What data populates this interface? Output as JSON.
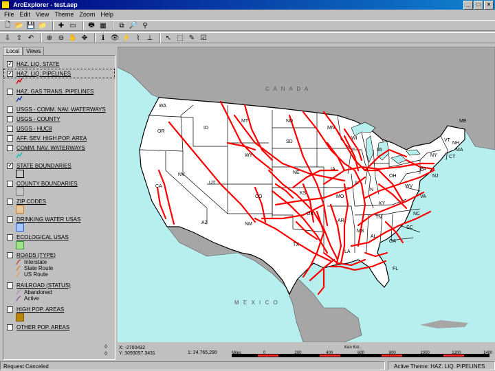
{
  "window": {
    "title": "ArcExplorer - test.aep",
    "minimize": "_",
    "maximize": "□",
    "close": "×"
  },
  "menu": [
    "File",
    "Edit",
    "View",
    "Theme",
    "Zoom",
    "Help"
  ],
  "toolbar1": [
    {
      "icon": "new-icon",
      "glyph": "🗋"
    },
    {
      "icon": "open-icon",
      "glyph": "📂"
    },
    {
      "icon": "save-icon",
      "glyph": "💾"
    },
    {
      "icon": "open-folder-icon",
      "glyph": "📁"
    },
    {
      "icon": "add-theme-icon",
      "glyph": "✚"
    },
    {
      "icon": "remove-theme-icon",
      "glyph": "▭"
    },
    {
      "icon": "print-icon",
      "glyph": "🖶"
    },
    {
      "icon": "table-icon",
      "glyph": "▦"
    },
    {
      "icon": "copy-map-icon",
      "glyph": "⧉"
    },
    {
      "icon": "query-icon",
      "glyph": "🔎"
    },
    {
      "icon": "locate-icon",
      "glyph": "⚲"
    }
  ],
  "toolbar2": [
    {
      "icon": "export-icon",
      "glyph": "⇩"
    },
    {
      "icon": "import-icon",
      "glyph": "⇧"
    },
    {
      "icon": "undo-icon",
      "glyph": "↶"
    },
    {
      "icon": "zoom-in-icon",
      "glyph": "⊕"
    },
    {
      "icon": "zoom-out-icon",
      "glyph": "⊖"
    },
    {
      "icon": "pan-icon",
      "glyph": "✋"
    },
    {
      "icon": "move-icon",
      "glyph": "✥"
    },
    {
      "icon": "identify-icon",
      "glyph": "ℹ"
    },
    {
      "icon": "find-icon",
      "glyph": "👁"
    },
    {
      "icon": "hyperlink-icon",
      "glyph": "⚡"
    },
    {
      "icon": "measure-icon",
      "glyph": "⌇"
    },
    {
      "icon": "buffer-icon",
      "glyph": "⊥"
    },
    {
      "icon": "select-icon",
      "glyph": "↖"
    },
    {
      "icon": "select-box-icon",
      "glyph": "⬚"
    },
    {
      "icon": "clear-selection-icon",
      "glyph": "✎"
    },
    {
      "icon": "properties-icon",
      "glyph": "☑"
    }
  ],
  "tabs": [
    "Local",
    "Views"
  ],
  "layers": [
    {
      "name": "HAZ. LIQ. STATE",
      "checked": true
    },
    {
      "name": "HAZ. LIQ. PIPELINES",
      "checked": true,
      "symbol_color": "#e00000"
    },
    {
      "name": "HAZ. GAS TRANS. PIPELINES",
      "checked": false,
      "symbol_color": "#1f3fb0"
    },
    {
      "name": "USGS - COMM. NAV. WATERWAYS",
      "checked": false
    },
    {
      "name": "USGS - COUNTY",
      "checked": false
    },
    {
      "name": "USGS - HUC8",
      "checked": false
    },
    {
      "name": "AFF. SEV. HIGH POP. AREA",
      "checked": false
    },
    {
      "name": "COMM. NAV. WATERWAYS",
      "checked": false,
      "symbol_color": "#19c0c0"
    },
    {
      "name": "STATE BOUNDARIES",
      "checked": true,
      "symbol_fill": "#c8c8c8",
      "symbol_border": "#000"
    },
    {
      "name": "COUNTY BOUNDARIES",
      "checked": false,
      "symbol_fill": "#c8c8c8",
      "symbol_border": "#808080"
    },
    {
      "name": "ZIP CODES",
      "checked": false,
      "symbol_fill": "#e7c89a",
      "symbol_border": "#d08030"
    },
    {
      "name": "DRINKING WATER USAS",
      "checked": false,
      "symbol_fill": "#a7c7ff",
      "symbol_border": "#3060d0"
    },
    {
      "name": "ECOLOGICAL USAS",
      "checked": false,
      "symbol_fill": "#9fe08a",
      "symbol_border": "#30a030"
    },
    {
      "name": "ROADS (TYPE)",
      "checked": false,
      "sub": [
        "Interstate",
        "State Route",
        "US Route"
      ]
    },
    {
      "name": "RAILROAD (STATUS)",
      "checked": false,
      "sub": [
        "Abandoned",
        "Active"
      ]
    },
    {
      "name": "HIGH POP. AREAS",
      "checked": false,
      "symbol_fill": "#b8860b",
      "symbol_border": "#8b5a00"
    },
    {
      "name": "OTHER POP. AREAS",
      "checked": false
    }
  ],
  "map": {
    "labels": {
      "canada": "C A N A D A",
      "mexico": "M E X I C O"
    },
    "states": [
      "WA",
      "OR",
      "CA",
      "NV",
      "ID",
      "MT",
      "WY",
      "UT",
      "AZ",
      "CO",
      "NM",
      "ND",
      "SD",
      "NE",
      "KS",
      "OK",
      "TX",
      "MN",
      "IA",
      "MO",
      "AR",
      "LA",
      "WI",
      "IL",
      "MI",
      "IN",
      "OH",
      "KY",
      "TN",
      "MS",
      "AL",
      "GA",
      "FL",
      "SC",
      "NC",
      "VA",
      "WV",
      "PA",
      "NY",
      "ME",
      "VT",
      "NH",
      "MA",
      "CT",
      "NJ"
    ],
    "pipeline_color": "#ff0000",
    "water_color": "#b7efef",
    "land_color": "#ffffff",
    "other_land_color": "#a6a6a6"
  },
  "coords": {
    "x": "X: -2700432",
    "y": "Y: 3093057.3431"
  },
  "scale": {
    "text": "1: 24,765,290",
    "units": "Miles",
    "head": "Ken Kst...",
    "ticks": [
      "Miles",
      "0",
      "200",
      "400",
      "600",
      "800",
      "1000",
      "1200",
      "1400"
    ]
  },
  "status": {
    "left": "Request Canceled",
    "right": "Active Theme: HAZ. LIQ. PIPELINES"
  }
}
